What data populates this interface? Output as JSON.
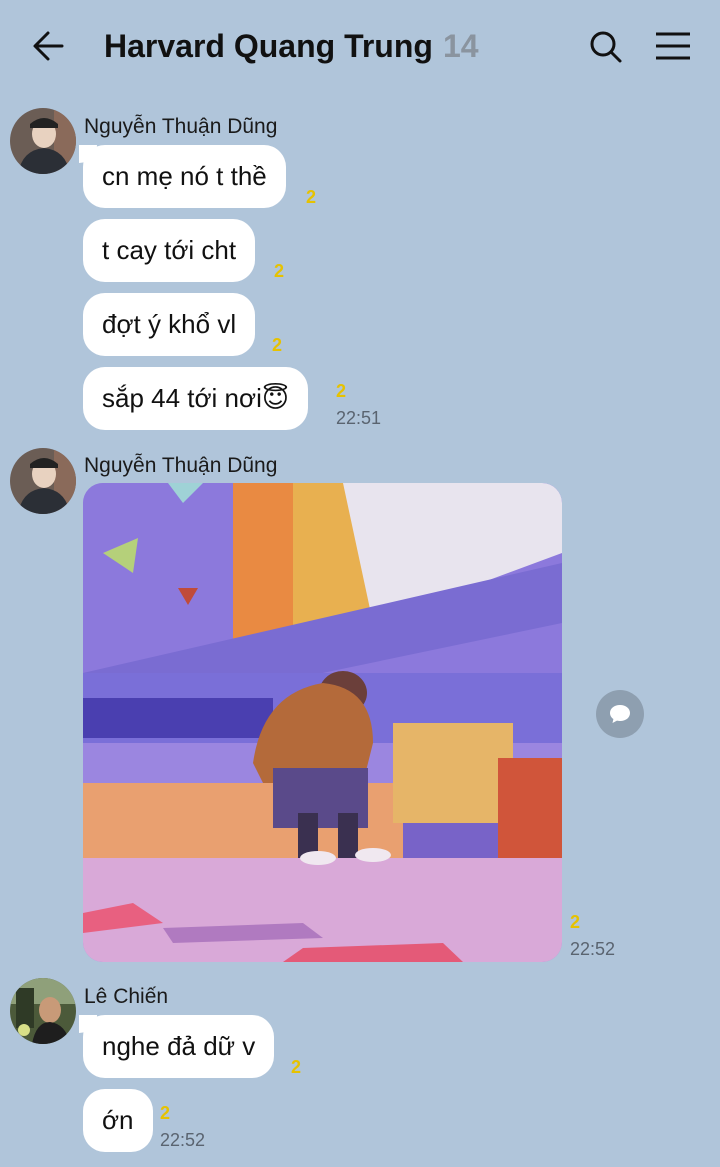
{
  "header": {
    "title": "Harvard Quang Trung",
    "member_count": "14"
  },
  "groups": [
    {
      "sender": "Nguyễn Thuận Dũng",
      "messages": [
        {
          "text": "cn mẹ nó t thề",
          "unread": "2"
        },
        {
          "text": "t cay tới cht",
          "unread": "2"
        },
        {
          "text": "đợt ý khổ vl",
          "unread": "2"
        },
        {
          "text": "sắp 44 tới nơi😇",
          "unread": "2",
          "time": "22:51"
        }
      ]
    },
    {
      "sender": "Nguyễn Thuận Dũng",
      "photo": {
        "unread": "2",
        "time": "22:52"
      }
    },
    {
      "sender": "Lê Chiến",
      "messages": [
        {
          "text": "nghe đả dữ v",
          "unread": "2"
        },
        {
          "text": "ớn",
          "unread": "2",
          "time": "22:52"
        }
      ]
    }
  ],
  "colors": {
    "background": "#b0c5da",
    "bubble": "#ffffff",
    "unread": "#e6c200"
  }
}
